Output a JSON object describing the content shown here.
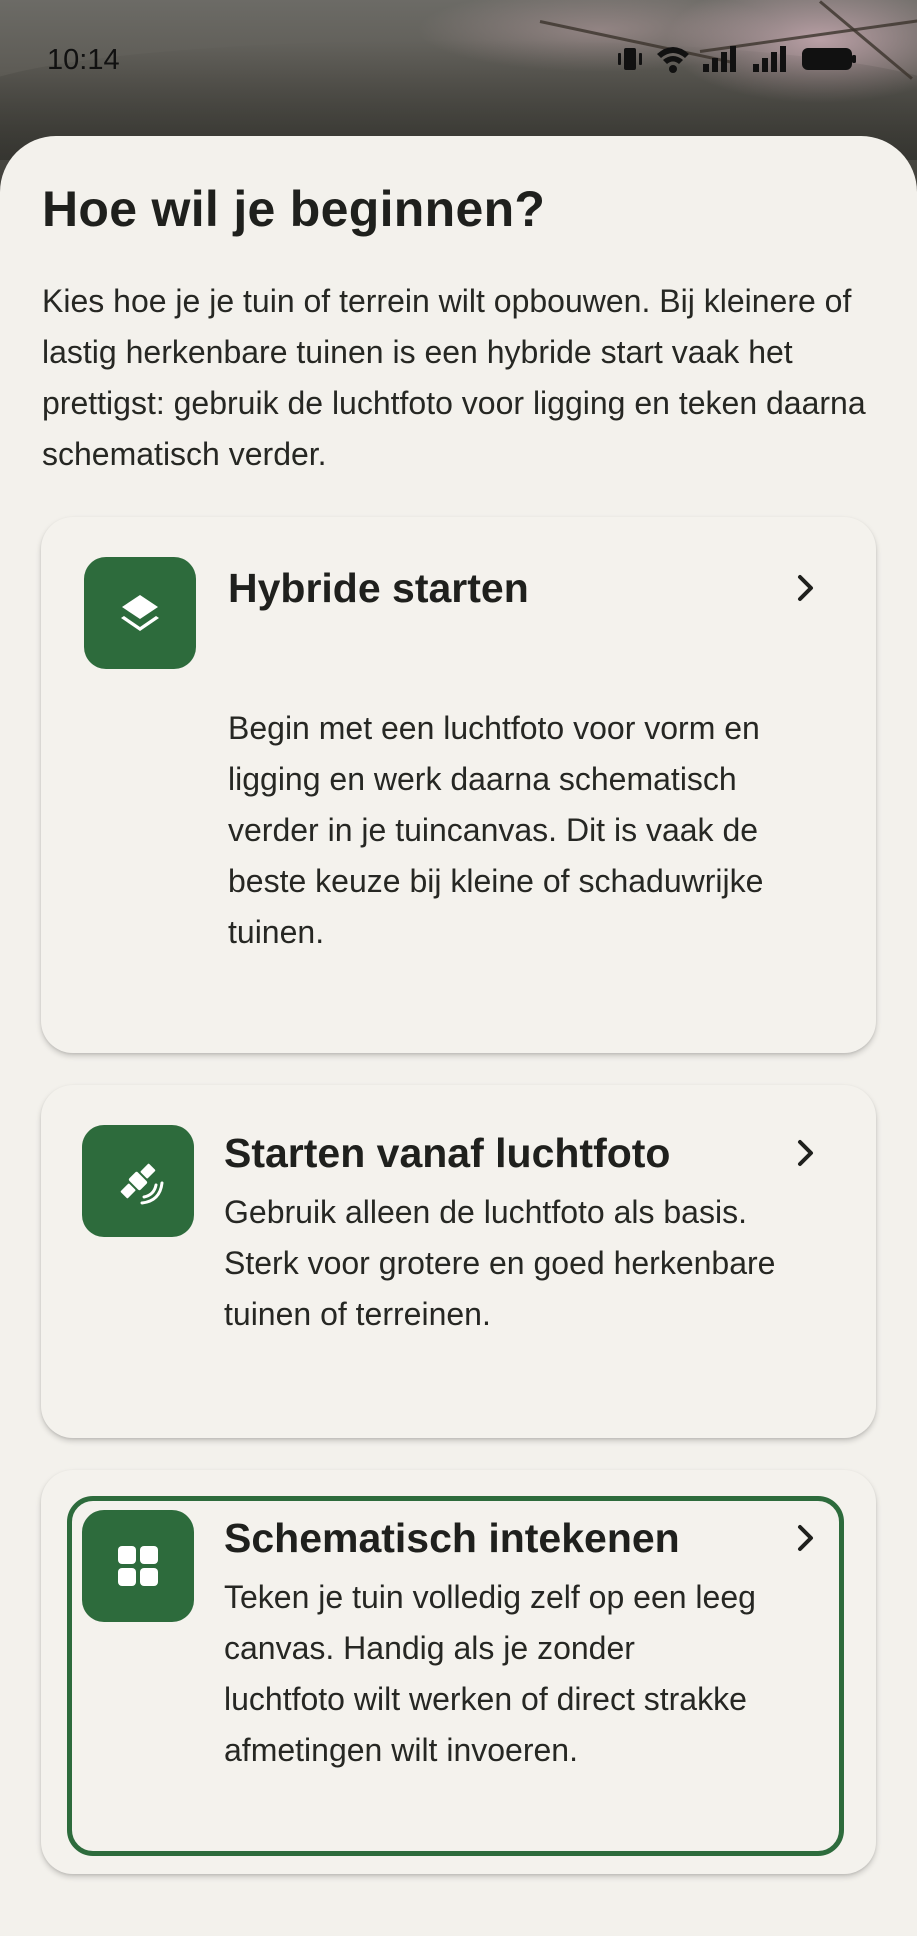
{
  "status_bar": {
    "time": "10:14",
    "icons": [
      "vibrate-icon",
      "wifi-icon",
      "signal-icon",
      "signal-icon",
      "battery-icon"
    ]
  },
  "sheet": {
    "title": "Hoe wil je beginnen?",
    "intro": "Kies hoe je je tuin of terrein wilt opbouwen. Bij kleinere of lastig herkenbare tuinen is een hybride start vaak het prettigst: gebruik de luchtfoto voor ligging en teken daarna schematisch verder."
  },
  "options": [
    {
      "icon": "layers-icon",
      "title": "Hybride starten",
      "description": "Begin met een luchtfoto voor vorm en ligging en werk daarna schematisch verder in je tuincanvas. Dit is vaak de beste keuze bij kleine of schaduwrijke tuinen."
    },
    {
      "icon": "satellite-icon",
      "title": "Starten vanaf luchtfoto",
      "description": "Gebruik alleen de luchtfoto als basis. Sterk voor grotere en goed herkenbare tuinen of terreinen."
    },
    {
      "icon": "grid-icon",
      "title": "Schematisch intekenen",
      "description": "Teken je tuin volledig zelf op een leeg canvas. Handig als je zonder luchtfoto wilt werken of direct strakke afmetingen wilt invoeren."
    }
  ],
  "colors": {
    "accent": "#2d6b3c",
    "background": "#f3f1ec",
    "text": "#1f201d"
  }
}
